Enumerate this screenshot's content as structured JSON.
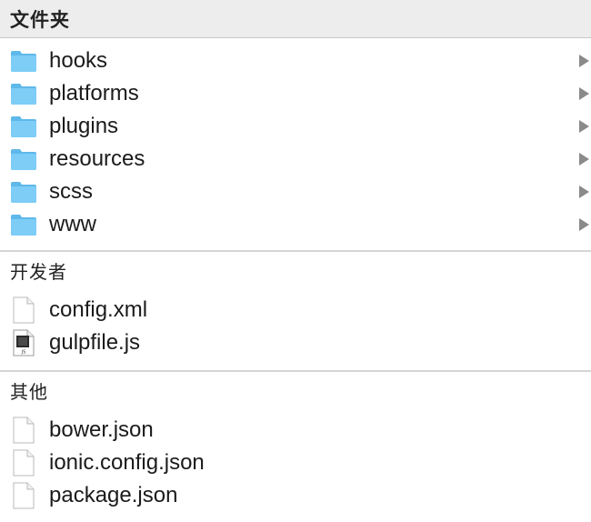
{
  "sections": {
    "folders": {
      "title": "文件夹",
      "items": [
        {
          "label": "hooks",
          "icon": "folder-icon"
        },
        {
          "label": "platforms",
          "icon": "folder-icon"
        },
        {
          "label": "plugins",
          "icon": "folder-icon"
        },
        {
          "label": "resources",
          "icon": "folder-icon"
        },
        {
          "label": "scss",
          "icon": "folder-icon"
        },
        {
          "label": "www",
          "icon": "folder-icon"
        }
      ]
    },
    "developer": {
      "title": "开发者",
      "items": [
        {
          "label": "config.xml",
          "icon": "document-icon"
        },
        {
          "label": "gulpfile.js",
          "icon": "js-file-icon"
        }
      ]
    },
    "other": {
      "title": "其他",
      "items": [
        {
          "label": "bower.json",
          "icon": "document-icon"
        },
        {
          "label": "ionic.config.json",
          "icon": "document-icon"
        },
        {
          "label": "package.json",
          "icon": "document-icon"
        }
      ]
    }
  },
  "colors": {
    "folder": "#6cc5f5",
    "folder_tab": "#5fb8ea",
    "header_bg": "#ededed",
    "chevron": "#8a8a8a"
  }
}
